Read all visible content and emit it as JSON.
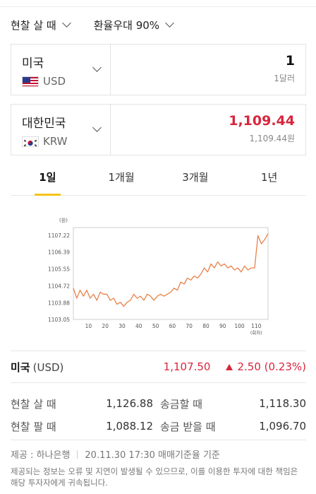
{
  "selectors": {
    "mode": "현찰 살 때",
    "discount": "환율우대 90%"
  },
  "from": {
    "country": "미국",
    "code": "USD",
    "amount": "1",
    "amount_text": "1달러"
  },
  "to": {
    "country": "대한민국",
    "code": "KRW",
    "amount": "1,109.44",
    "amount_text": "1,109.44원"
  },
  "tabs": [
    {
      "label": "1일",
      "active": true
    },
    {
      "label": "1개월",
      "active": false
    },
    {
      "label": "3개월",
      "active": false
    },
    {
      "label": "1년",
      "active": false
    }
  ],
  "summary": {
    "country": "미국",
    "code": "(USD)",
    "price": "1,107.50",
    "change": "2.50 (0.23%)"
  },
  "rates": {
    "cash_buy_label": "현찰 살 때",
    "cash_buy": "1,126.88",
    "send_label": "송금할 때",
    "send": "1,118.30",
    "cash_sell_label": "현찰 팔 때",
    "cash_sell": "1,088.12",
    "receive_label": "송금 받을 때",
    "receive": "1,096.70"
  },
  "footer": {
    "provider": "제공 : 하나은행",
    "timestamp": "20.11.30 17:30 매매기준율 기준",
    "disclaimer": "제공되는 정보는 오류 및 지연이 발생될 수 있으므로, 이를 이용한 투자에 대한 책임은 해당 투자자에게 귀속됩니다."
  },
  "colors": {
    "accent_red": "#d7263d",
    "line": "#e8824a",
    "tab_underline": "#f5c518"
  },
  "chart_data": {
    "type": "line",
    "ylabel": "(원)",
    "xlabel": "(회차)",
    "x_ticks": [
      10,
      20,
      30,
      40,
      50,
      60,
      70,
      80,
      90,
      100,
      110
    ],
    "y_ticks": [
      "1107.22",
      "1106.39",
      "1105.55",
      "1104.72",
      "1103.88",
      "1103.05"
    ],
    "ylim": [
      1103.05,
      1107.6
    ],
    "xlim": [
      1,
      117
    ],
    "grid": "off",
    "series": [
      {
        "x": [
          1,
          3,
          5,
          7,
          9,
          11,
          13,
          15,
          17,
          19,
          21,
          23,
          25,
          27,
          29,
          31,
          33,
          35,
          37,
          39,
          41,
          43,
          45,
          47,
          49,
          51,
          53,
          55,
          57,
          59,
          61,
          63,
          65,
          67,
          69,
          71,
          73,
          75,
          77,
          79,
          81,
          83,
          85,
          87,
          89,
          91,
          93,
          95,
          97,
          99,
          101,
          103,
          105,
          107,
          109,
          110,
          111,
          113,
          115,
          117
        ],
        "values": [
          1104.6,
          1104.1,
          1104.5,
          1104.2,
          1104.5,
          1104.1,
          1104.3,
          1104.0,
          1104.4,
          1104.3,
          1104.3,
          1104.0,
          1104.1,
          1103.8,
          1103.9,
          1103.7,
          1103.9,
          1104.0,
          1104.3,
          1104.1,
          1104.2,
          1104.0,
          1104.3,
          1104.2,
          1104.0,
          1104.2,
          1104.3,
          1104.2,
          1104.3,
          1104.4,
          1104.6,
          1104.5,
          1104.9,
          1104.8,
          1105.1,
          1105.0,
          1105.2,
          1105.1,
          1105.3,
          1105.6,
          1105.4,
          1105.8,
          1105.6,
          1105.9,
          1105.7,
          1105.8,
          1105.6,
          1105.7,
          1105.5,
          1105.6,
          1105.4,
          1105.7,
          1105.5,
          1105.6,
          1105.6,
          1106.4,
          1107.2,
          1106.8,
          1107.0,
          1107.3
        ]
      }
    ]
  }
}
